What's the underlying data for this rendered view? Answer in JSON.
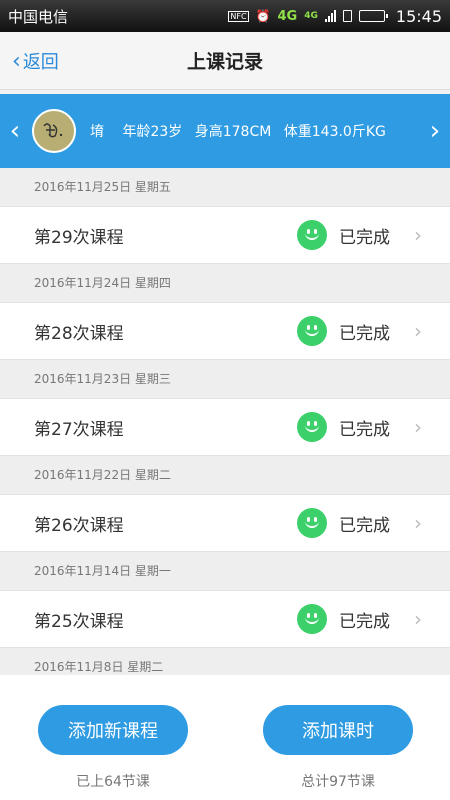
{
  "statusbar": {
    "carrier": "中国电信",
    "icons": [
      "nfc-icon",
      "alarm-icon",
      "signal-icon",
      "sim-icon",
      "battery-icon"
    ],
    "net1": "4G",
    "net2": "4G",
    "time": "15:45"
  },
  "navbar": {
    "back_label": "返回",
    "title": "上课记录"
  },
  "profile": {
    "name": "堉",
    "age": "年龄23岁",
    "height": "身高178CM",
    "weight": "体重143.0斤KG"
  },
  "records": [
    {
      "date": "2016年11月25日  星期五",
      "course": "第29次课程",
      "status": "已完成"
    },
    {
      "date": "2016年11月24日  星期四",
      "course": "第28次课程",
      "status": "已完成"
    },
    {
      "date": "2016年11月23日  星期三",
      "course": "第27次课程",
      "status": "已完成"
    },
    {
      "date": "2016年11月22日  星期二",
      "course": "第26次课程",
      "status": "已完成"
    },
    {
      "date": "2016年11月14日  星期一",
      "course": "第25次课程",
      "status": "已完成"
    },
    {
      "date": "2016年11月8日  星期二",
      "course": "",
      "status": ""
    }
  ],
  "bottom": {
    "add_course_label": "添加新课程",
    "add_hours_label": "添加课时",
    "taken_note": "已上64节课",
    "total_note": "总计97节课"
  },
  "colors": {
    "accent": "#2e9be3",
    "status_green": "#3bd06a"
  }
}
